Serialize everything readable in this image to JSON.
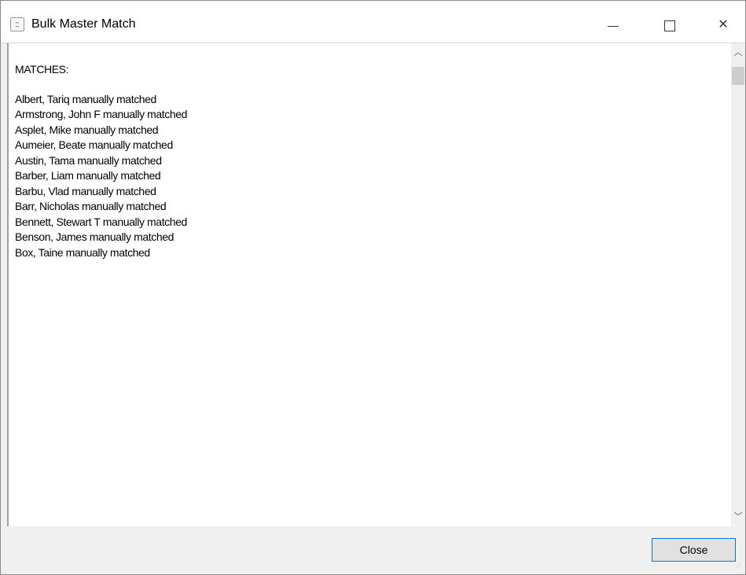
{
  "window": {
    "title": "Bulk Master Match",
    "icon": "app-icon"
  },
  "content": {
    "heading": "MATCHES:",
    "matches": [
      "Albert, Tariq manually matched",
      "Armstrong, John F manually matched",
      "Asplet, Mike manually matched",
      "Aumeier, Beate manually matched",
      "Austin, Tama manually matched",
      "Barber, Liam manually matched",
      "Barbu, Vlad manually matched",
      "Barr, Nicholas manually matched",
      "Bennett, Stewart T manually matched",
      "Benson, James manually matched",
      "Box, Taine manually matched"
    ]
  },
  "footer": {
    "close_label": "Close"
  },
  "colors": {
    "accent": "#0078d7",
    "background": "#f0f0f0"
  }
}
